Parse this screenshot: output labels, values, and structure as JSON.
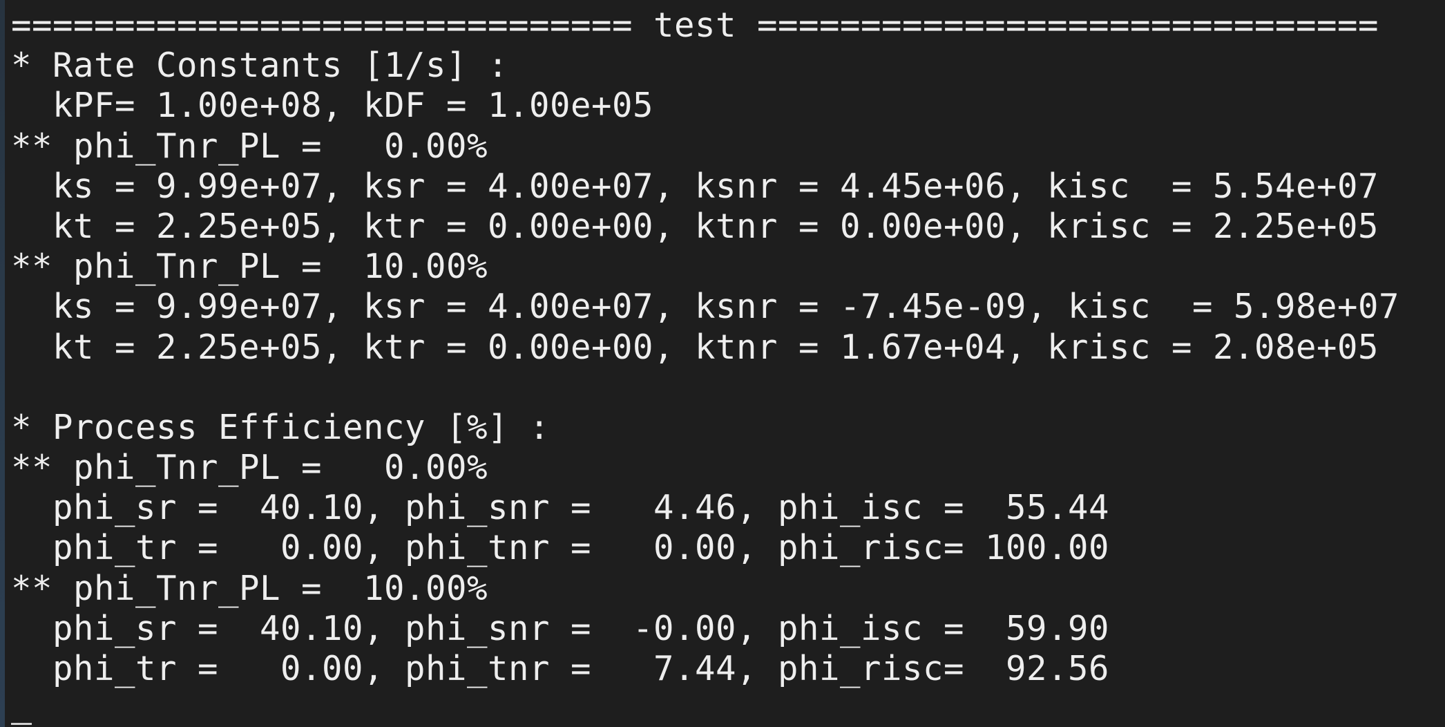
{
  "terminal": {
    "lines": [
      "============================== test ==============================",
      "* Rate Constants [1/s] :",
      "  kPF= 1.00e+08, kDF = 1.00e+05",
      "** phi_Tnr_PL =   0.00%",
      "  ks = 9.99e+07, ksr = 4.00e+07, ksnr = 4.45e+06, kisc  = 5.54e+07",
      "  kt = 2.25e+05, ktr = 0.00e+00, ktnr = 0.00e+00, krisc = 2.25e+05",
      "** phi_Tnr_PL =  10.00%",
      "  ks = 9.99e+07, ksr = 4.00e+07, ksnr = -7.45e-09, kisc  = 5.98e+07",
      "  kt = 2.25e+05, ktr = 0.00e+00, ktnr = 1.67e+04, krisc = 2.08e+05",
      "",
      "* Process Efficiency [%] :",
      "** phi_Tnr_PL =   0.00%",
      "  phi_sr =  40.10, phi_snr =   4.46, phi_isc =  55.44",
      "  phi_tr =   0.00, phi_tnr =   0.00, phi_risc= 100.00",
      "** phi_Tnr_PL =  10.00%",
      "  phi_sr =  40.10, phi_snr =  -0.00, phi_isc =  59.90",
      "  phi_tr =   0.00, phi_tnr =   7.44, phi_risc=  92.56"
    ]
  }
}
